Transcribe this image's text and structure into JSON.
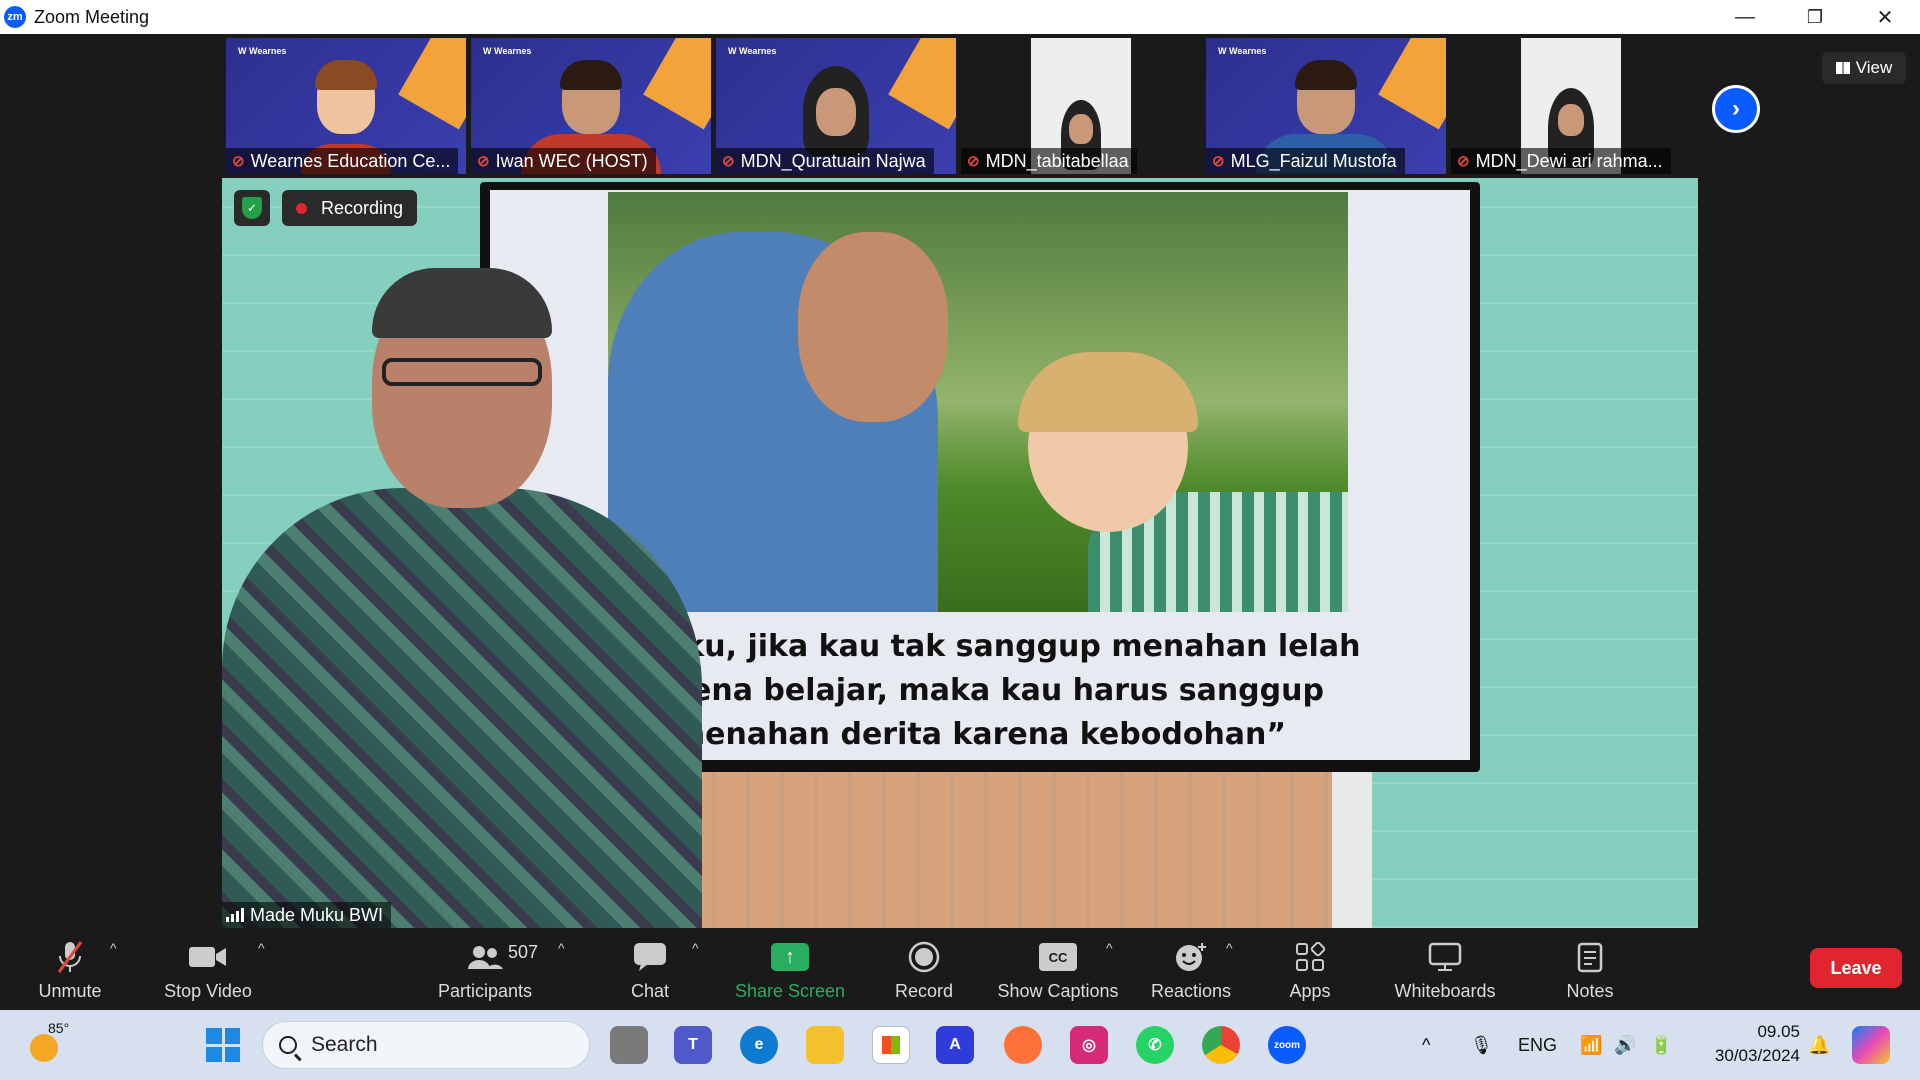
{
  "window": {
    "title": "Zoom Meeting",
    "app_badge": "zm",
    "minimize": "—",
    "restore": "❐",
    "close": "✕"
  },
  "participants_strip": [
    {
      "name": "Wearnes Education Ce...",
      "brand": "W Wearnes",
      "muted": true
    },
    {
      "name": "Iwan WEC (HOST)",
      "brand": "W Wearnes",
      "muted": true
    },
    {
      "name": "MDN_Quratuain  Najwa",
      "brand": "W Wearnes",
      "muted": true
    },
    {
      "name": "MDN_tabitabellaa",
      "brand": "",
      "muted": true
    },
    {
      "name": "MLG_Faizul Mustofa",
      "brand": "W Wearnes",
      "muted": true
    },
    {
      "name": "MDN_Dewi ari rahma...",
      "brand": "",
      "muted": true
    }
  ],
  "strip_next_icon": "›",
  "view_button": {
    "label": "View"
  },
  "main_video": {
    "speaker_name": "Made Muku BWI",
    "recording_label": "Recording",
    "slide_quote": [
      "Anakku, jika kau tak sanggup menahan lelah",
      "karena belajar, maka kau harus sanggup",
      "menahan derita karena kebodohan”"
    ]
  },
  "toolbar": {
    "unmute": "Unmute",
    "stop_video": "Stop Video",
    "participants": "Participants",
    "participants_count": "507",
    "chat": "Chat",
    "share_screen": "Share Screen",
    "record": "Record",
    "show_captions": "Show Captions",
    "cc_badge": "CC",
    "reactions": "Reactions",
    "apps": "Apps",
    "whiteboards": "Whiteboards",
    "notes": "Notes",
    "leave": "Leave",
    "caret": "^"
  },
  "taskbar": {
    "temperature": "85°",
    "search_placeholder": "Search",
    "tray_language": "ENG",
    "tray_caret": "^",
    "time": "09.05",
    "date": "30/03/2024",
    "zoom_icon_label": "zoom"
  },
  "colors": {
    "accent": "#0b5cff",
    "leave": "#e0252f",
    "share": "#27ae60",
    "recording_dot": "#e0252f"
  }
}
